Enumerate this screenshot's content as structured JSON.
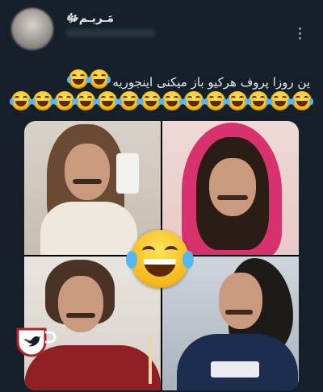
{
  "tweet": {
    "author": {
      "display_name": "مَـریـمﷻ",
      "avatar_icon": "avatar-icon"
    },
    "text": "ین روزا پروف هرکیو باز میکنی اینجوریه",
    "text_emoji_count": 2,
    "emoji_row_count": 14,
    "emoji_name": "face-with-tears-of-joy",
    "media": {
      "photos": [
        "photo-top-left",
        "photo-top-right",
        "photo-bottom-left",
        "photo-bottom-right"
      ],
      "overlay_emoji": "face-with-tears-of-joy"
    }
  },
  "watermark": {
    "icon": "twitter-cup-logo",
    "colors": {
      "cup": "#ffffff",
      "bird": "#ffffff",
      "cup_outline": "#b3202a"
    }
  },
  "colors": {
    "background": "#15202b",
    "text": "#e7e9ea",
    "secondary": "#8b98a5"
  }
}
